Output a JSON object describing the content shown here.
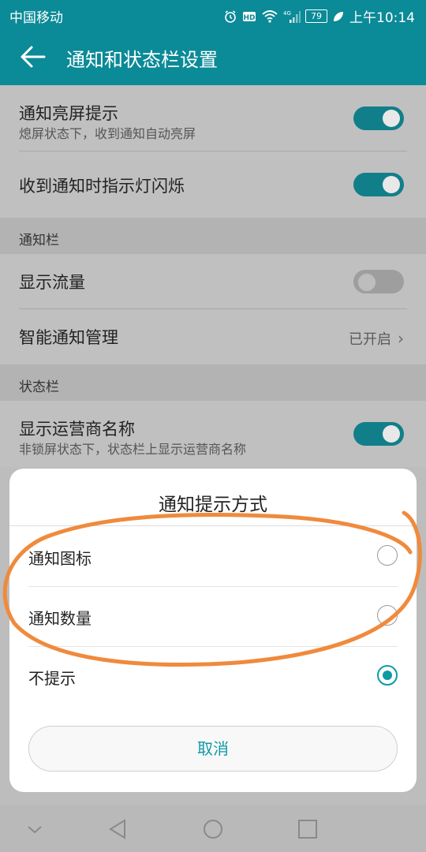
{
  "status_bar": {
    "carrier": "中国移动",
    "icons": [
      "alarm-icon",
      "hd-icon",
      "wifi-icon",
      "4g-signal-icon",
      "battery-icon",
      "leaf-icon"
    ],
    "battery": "79",
    "time": "上午10:14"
  },
  "app_bar": {
    "title": "通知和状态栏设置",
    "back_icon": "arrow-left-icon"
  },
  "settings": {
    "row1": {
      "label": "通知亮屏提示",
      "sub": "熄屏状态下，收到通知自动亮屏",
      "toggle": true
    },
    "row2": {
      "label": "收到通知时指示灯闪烁",
      "toggle": true
    },
    "section_notify": "通知栏",
    "row3": {
      "label": "显示流量",
      "toggle": false
    },
    "row4": {
      "label": "智能通知管理",
      "value": "已开启"
    },
    "section_status": "状态栏",
    "row5": {
      "label": "显示运营商名称",
      "sub": "非锁屏状态下，状态栏上显示运营商名称",
      "toggle": true
    }
  },
  "dialog": {
    "title": "通知提示方式",
    "options": [
      {
        "label": "通知图标",
        "selected": false
      },
      {
        "label": "通知数量",
        "selected": false
      },
      {
        "label": "不提示",
        "selected": true
      }
    ],
    "cancel": "取消"
  },
  "colors": {
    "accent": "#0b8a97",
    "toggle_on": "#117f8a",
    "radio": "#0e9aa7",
    "annotation": "#f08a3c"
  },
  "nav_bar": {
    "icons": [
      "chevron-down-icon",
      "back-triangle-icon",
      "home-circle-icon",
      "recents-square-icon"
    ]
  }
}
